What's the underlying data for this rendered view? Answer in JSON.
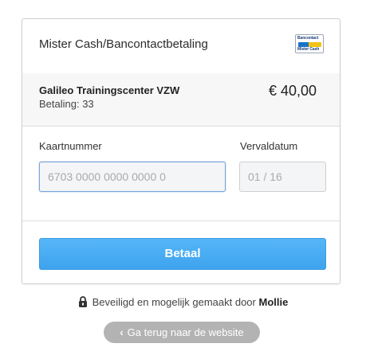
{
  "header": {
    "title": "Mister Cash/Bancontactbetaling",
    "logo_text_top": "Bancontact",
    "logo_text_bottom": "Mister Cash"
  },
  "merchant": {
    "name": "Galileo Trainingscenter VZW",
    "payment_ref": "Betaling: 33",
    "amount": "€ 40,00"
  },
  "form": {
    "card_label": "Kaartnummer",
    "card_placeholder": "6703 0000 0000 0000 0",
    "expiry_label": "Vervaldatum",
    "expiry_placeholder": "01 / 16"
  },
  "pay_button": "Betaal",
  "footer": {
    "secure_text": "Beveiligd en mogelijk gemaakt door",
    "provider": "Mollie",
    "back_button": "Ga terug naar de website"
  },
  "colors": {
    "primary_button": "#4aaef3",
    "back_button": "#b3b3b3",
    "focus_border": "#7aa4d9"
  }
}
